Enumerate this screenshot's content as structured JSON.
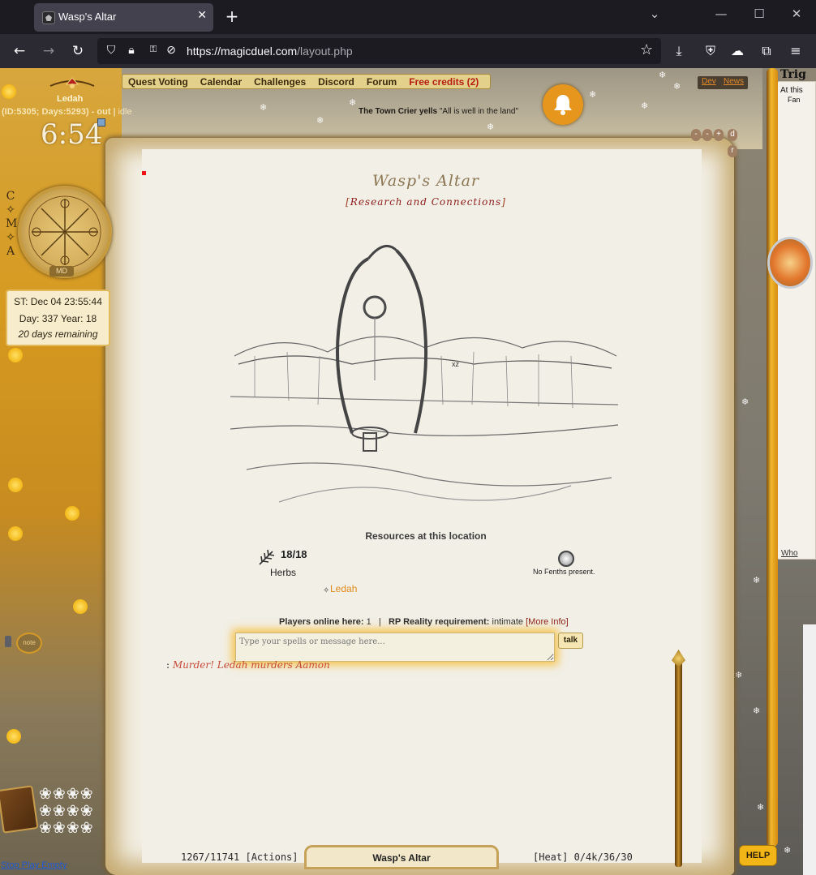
{
  "browser": {
    "tab_title": "Wasp's Altar",
    "url_host": "https://magicduel.com",
    "url_path": "/layout.php"
  },
  "menu": {
    "items": [
      "Quest Voting",
      "Calendar",
      "Challenges",
      "Discord",
      "Forum"
    ],
    "credits": "Free credits (2)",
    "dev": "Dev",
    "news": "News"
  },
  "crier": {
    "label": "The Town Crier yells",
    "message": "\"All is well in the land\""
  },
  "player": {
    "name": "Ledah",
    "id_info": "(ID:5305; Days:5293) - ",
    "out": "out",
    "separator": "|",
    "idle": "idle",
    "clock": "6:54"
  },
  "sidebar": {
    "letters": [
      "C",
      "✧",
      "M",
      "✧",
      "A"
    ],
    "compass_label": "MD"
  },
  "time": {
    "st": "ST: Dec 04 23:55:44",
    "day_year": "Day: 337 Year: 18",
    "remaining": "20 days remaining"
  },
  "left_footer": {
    "note": "note",
    "links": "Stop Play Empty"
  },
  "zoom_controls": [
    "-",
    "-",
    "+",
    "d",
    "r"
  ],
  "right_panel": {
    "title": "Trig",
    "line1": "At this",
    "line2": "Fan",
    "link": "Who"
  },
  "location": {
    "title": "Wasp's Altar",
    "subtitle_open": "[",
    "subtitle": "Research and Connections",
    "subtitle_close": "]",
    "sketch_mark": "xz"
  },
  "resources": {
    "title": "Resources at this location",
    "herb_count": "18/18",
    "herb_label": "Herbs",
    "fenths": "No Fenths present."
  },
  "players": {
    "marker": "✧",
    "name": "Ledah",
    "online_label": "Players online here:",
    "online_count": "1",
    "divider": "|",
    "rp_label": "RP Reality requirement:",
    "rp_value": "intimate",
    "more_info": "[More Info]"
  },
  "chat": {
    "placeholder": "Type your spells or message here...",
    "talk_label": "talk",
    "log_colon": ":",
    "log_message": "Murder! Ledah murders Aamon"
  },
  "footer": {
    "actions": "1267/11741 [Actions]",
    "location": "Wasp's Altar",
    "heat": "[Heat] 0/4k/36/30"
  },
  "help_label": "HELP",
  "colors": {
    "accent_orange": "#e7961d",
    "menu_bg": "#e3d08a",
    "credits_red": "#b51c12",
    "parchment": "#f2efe4"
  }
}
